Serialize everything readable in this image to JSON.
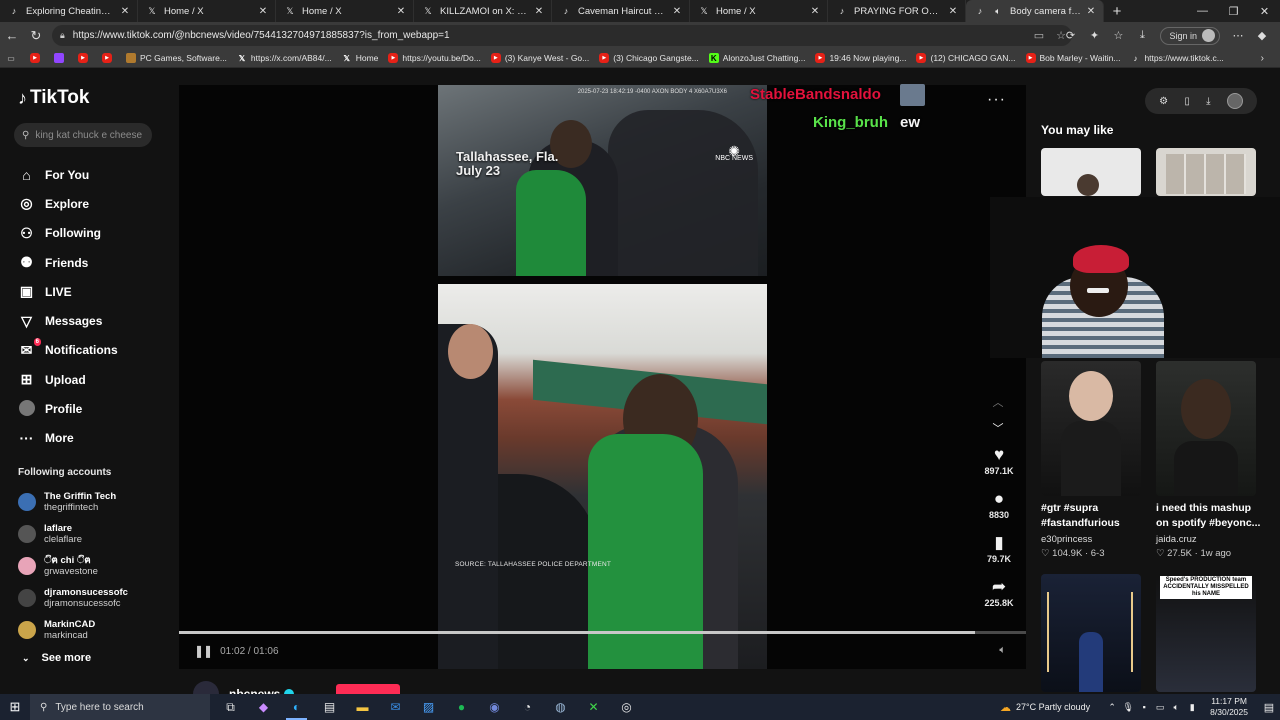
{
  "browser": {
    "tabs": [
      {
        "label": "Exploring Cheating in Bible",
        "icon": "tiktok-icon",
        "active": false
      },
      {
        "label": "Home / X",
        "icon": "x-icon",
        "active": false
      },
      {
        "label": "Home / X",
        "icon": "x-icon",
        "active": false
      },
      {
        "label": "KILLZAMOI on X: \"omg htt",
        "icon": "x-icon",
        "active": false
      },
      {
        "label": "Caveman Haircut Fiasco: A",
        "icon": "tiktok-icon",
        "active": false
      },
      {
        "label": "Home / X",
        "icon": "x-icon",
        "active": false
      },
      {
        "label": "PRAYING FOR OUR LITTLE",
        "icon": "tiktok-icon",
        "active": false
      },
      {
        "label": "Body camera footage",
        "icon": "tiktok-icon",
        "active": true
      }
    ],
    "url": "https://www.tiktok.com/@nbcnews/video/7544132704971885837?is_from_webapp=1",
    "signin_label": "Sign in",
    "bookmarks": [
      {
        "label": "",
        "icon": "youtube-icon"
      },
      {
        "label": "",
        "icon": "twitch-icon"
      },
      {
        "label": "",
        "icon": "youtube-icon"
      },
      {
        "label": "",
        "icon": "youtube-icon"
      },
      {
        "label": "PC Games, Software...",
        "icon": "games-icon"
      },
      {
        "label": "https://x.com/AB84/...",
        "icon": "x-icon"
      },
      {
        "label": "Home",
        "icon": "x-icon"
      },
      {
        "label": "https://youtu.be/Do...",
        "icon": "youtube-icon"
      },
      {
        "label": "(3) Kanye West - Go...",
        "icon": "youtube-icon"
      },
      {
        "label": "(3) Chicago Gangste...",
        "icon": "youtube-icon"
      },
      {
        "label": "AlonzoJust Chatting...",
        "icon": "kick-icon"
      },
      {
        "label": "19:46 Now playing...",
        "icon": "youtube-icon"
      },
      {
        "label": "(12) CHICAGO GAN...",
        "icon": "youtube-icon"
      },
      {
        "label": "Bob Marley - Waitin...",
        "icon": "youtube-icon"
      },
      {
        "label": "https://www.tiktok.c...",
        "icon": "tiktok-icon"
      }
    ]
  },
  "tiktok": {
    "logo": "TikTok",
    "search_placeholder": "king kat chuck e cheese",
    "nav": [
      {
        "label": "For You",
        "icon": "home-icon"
      },
      {
        "label": "Explore",
        "icon": "compass-icon"
      },
      {
        "label": "Following",
        "icon": "following-icon"
      },
      {
        "label": "Friends",
        "icon": "friends-icon"
      },
      {
        "label": "LIVE",
        "icon": "live-icon"
      },
      {
        "label": "Messages",
        "icon": "messages-icon"
      },
      {
        "label": "Notifications",
        "icon": "notifications-icon",
        "badge": "6"
      },
      {
        "label": "Upload",
        "icon": "upload-icon"
      },
      {
        "label": "Profile",
        "icon": "profile-avatar"
      },
      {
        "label": "More",
        "icon": "more-icon"
      }
    ],
    "following_title": "Following accounts",
    "following": [
      {
        "name": "The Griffin Tech",
        "handle": "thegriffintech",
        "color": "#3b6fb3"
      },
      {
        "name": "laflare",
        "handle": "clelaflare",
        "color": "#555555"
      },
      {
        "name": "ිฅ chi ිฅ",
        "handle": "grwavestone",
        "color": "#e8a4b8"
      },
      {
        "name": "djramonsucessofc",
        "handle": "djramonsucessofc",
        "color": "#444444"
      },
      {
        "name": "MarkinCAD",
        "handle": "markincad",
        "color": "#caa44a"
      }
    ],
    "see_more": "See more"
  },
  "video": {
    "overlay_location": "Tallahassee, Fla.",
    "overlay_date": "July 23",
    "overlay_stamp": "2025-07-23 18:42:19 -0400 AXON BODY 4 X60A7U3X6",
    "nbc_label": "NBC NEWS",
    "source_label": "SOURCE: TALLAHASSEE POLICE DEPARTMENT",
    "time_current": "01:02",
    "time_total": "01:06",
    "progress_fraction": 0.94,
    "chat": [
      {
        "user": "StableBandsnaldo",
        "message": "",
        "color": "#e3123c"
      },
      {
        "user": "King_bruh",
        "message": "ew",
        "color": "#59e34a"
      }
    ],
    "actions": [
      {
        "icon": "heart-icon",
        "count": "897.1K"
      },
      {
        "icon": "comment-icon",
        "count": "8830"
      },
      {
        "icon": "bookmark-icon",
        "count": "79.7K"
      },
      {
        "icon": "share-icon",
        "count": "225.8K"
      }
    ],
    "channel_name": "nbcnews"
  },
  "recommendations": {
    "title": "You may like",
    "items": [
      {
        "title": "#gtr #supra #fastandfurious",
        "author": "e30princess",
        "likes": "104.9K",
        "age": "6-3"
      },
      {
        "title": "i need this mashup on spotify #beyonc...",
        "author": "jaida.cruz",
        "likes": "27.5K",
        "age": "1w ago"
      }
    ],
    "thumb_caption": "Speed's PRODUCTION team ACCIDENTALLY MISSPELLED his NAME"
  },
  "taskbar": {
    "search_placeholder": "Type here to search",
    "weather": "27°C  Partly cloudy",
    "time": "11:17 PM",
    "date": "8/30/2025"
  }
}
